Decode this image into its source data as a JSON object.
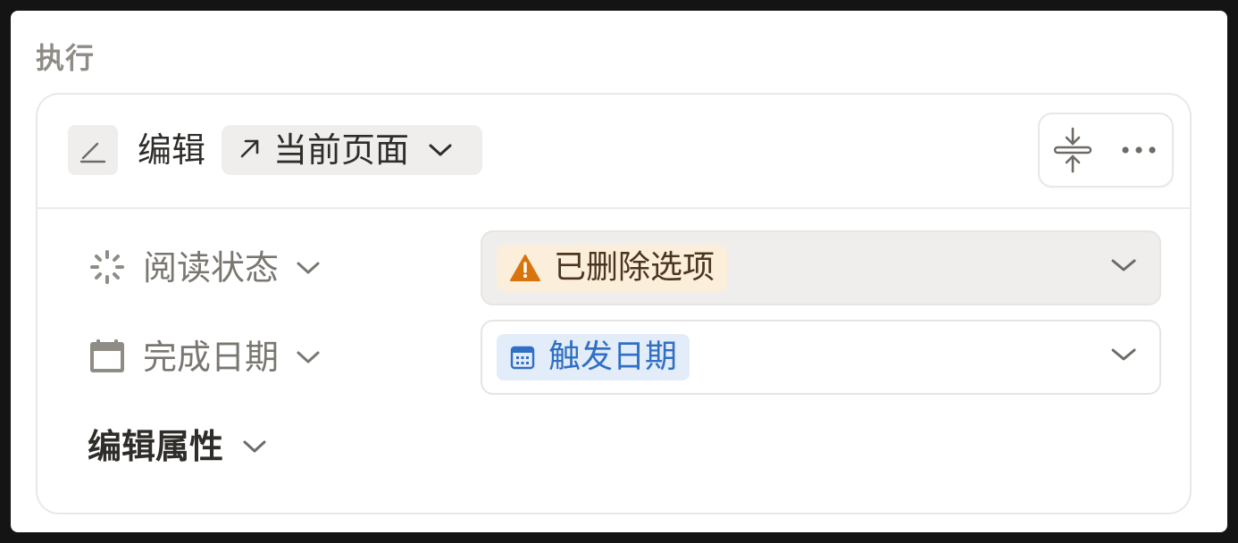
{
  "section": {
    "label": "执行"
  },
  "action": {
    "icon": "pencil-icon",
    "title": "编辑",
    "target": {
      "icon": "arrow-up-right-icon",
      "label": "当前页面"
    },
    "controls": {
      "collapse_icon": "collapse-vertical-icon",
      "more_icon": "more-horizontal-icon"
    }
  },
  "properties": [
    {
      "icon": "status-spinner-icon",
      "name": "阅读状态",
      "value": {
        "icon": "warning-icon",
        "text": "已删除选项",
        "style": "warning"
      }
    },
    {
      "icon": "calendar-icon",
      "name": "完成日期",
      "value": {
        "icon": "calendar-small-icon",
        "text": "触发日期",
        "style": "blue"
      }
    }
  ],
  "edit_properties": {
    "label": "编辑属性"
  },
  "colors": {
    "warning_icon": "#d9730d",
    "warning_bg": "#fbeeda",
    "blue_text": "#2f6fc4",
    "blue_bg": "#e3ecf9",
    "muted_text": "#7a7771"
  }
}
